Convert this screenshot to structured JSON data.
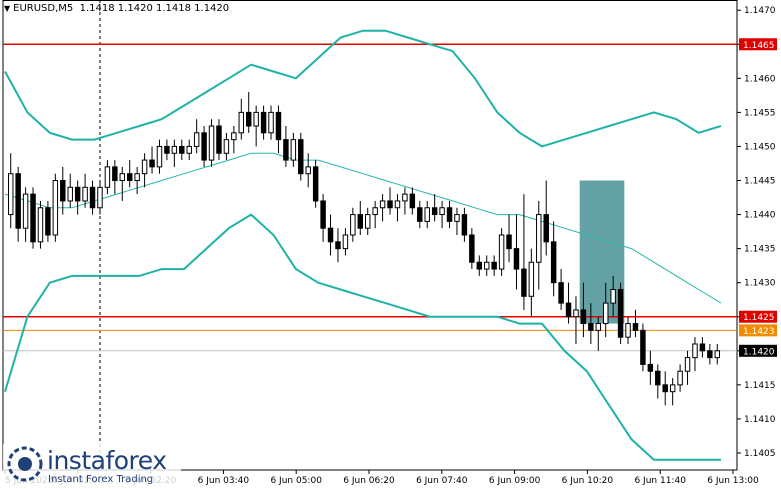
{
  "window": {
    "symbol_label": "EURUSD,M5",
    "ohlc": "1.1418 1.1420 1.1418 1.1420"
  },
  "colors": {
    "background": "#ffffff",
    "candle": "#000000",
    "bollinger_outer": "#1fb3a7",
    "bollinger_middle": "#27b5ab",
    "level_red": "#e00000",
    "level_orange": "#f08c00",
    "current_price_line": "#c0c0c0",
    "highlight_box": "#3d8a8e",
    "axis_tag_red": "#e00000",
    "axis_tag_orange": "#f08c00",
    "axis_tag_current": "#000000",
    "logo_text": "#1f3f78"
  },
  "price_axis": {
    "labels": [
      "1.1470",
      "1.1465",
      "1.1460",
      "1.1455",
      "1.1450",
      "1.1445",
      "1.1440",
      "1.1435",
      "1.1430",
      "1.1425",
      "1.1420",
      "1.1415",
      "1.1410",
      "1.1405"
    ]
  },
  "time_axis": {
    "labels": [
      "5 Jun 2025",
      "6 Jun 01:00",
      "6 Jun 02:20",
      "6 Jun 03:40",
      "6 Jun 05:00",
      "6 Jun 06:20",
      "6 Jun 07:40",
      "6 Jun 09:00",
      "6 Jun 10:20",
      "6 Jun 11:40",
      "6 Jun 13:00"
    ]
  },
  "price_tags": [
    {
      "name": "level-1.1465",
      "text": "1.1465",
      "color": "#e00000"
    },
    {
      "name": "level-1.1425",
      "text": "1.1425",
      "color": "#e00000"
    },
    {
      "name": "level-1.1423",
      "text": "1.1423",
      "color": "#f08c00"
    },
    {
      "name": "current-price",
      "text": "1.1420",
      "color": "#000000"
    }
  ],
  "logo": {
    "name": "instaforex",
    "tagline": "Instant Forex Trading"
  },
  "chart_data": {
    "type": "candlestick",
    "symbol": "EURUSD",
    "timeframe": "M5",
    "ylim": [
      1.14025,
      1.14715
    ],
    "y_ticks": [
      1.1405,
      1.141,
      1.1415,
      1.142,
      1.1425,
      1.143,
      1.1435,
      1.144,
      1.1445,
      1.145,
      1.1455,
      1.146,
      1.1465,
      1.147
    ],
    "horizontal_levels": [
      {
        "price": 1.1465,
        "color": "#e00000",
        "style": "solid"
      },
      {
        "price": 1.1425,
        "color": "#e00000",
        "style": "solid"
      },
      {
        "price": 1.1423,
        "color": "#f08c00",
        "style": "solid"
      },
      {
        "price": 1.142,
        "color": "#c0c0c0",
        "style": "solid"
      }
    ],
    "vertical_marker": {
      "bar_index": 12,
      "style": "dashed"
    },
    "highlight_zone": {
      "from_bar": 77,
      "to_bar": 82,
      "price_low": 1.1424,
      "price_high": 1.1445
    },
    "candles": [
      [
        1.144,
        1.1449,
        1.1438,
        1.1446
      ],
      [
        1.1446,
        1.1447,
        1.1436,
        1.1438
      ],
      [
        1.1438,
        1.1444,
        1.1436,
        1.1443
      ],
      [
        1.1443,
        1.1444,
        1.1435,
        1.1436
      ],
      [
        1.1436,
        1.1442,
        1.1435,
        1.1441
      ],
      [
        1.1441,
        1.1442,
        1.1436,
        1.1437
      ],
      [
        1.1437,
        1.1446,
        1.1436,
        1.1445
      ],
      [
        1.1445,
        1.1447,
        1.144,
        1.1442
      ],
      [
        1.1442,
        1.1446,
        1.1441,
        1.1444
      ],
      [
        1.1444,
        1.1445,
        1.144,
        1.1442
      ],
      [
        1.1442,
        1.1446,
        1.1441,
        1.1444
      ],
      [
        1.1444,
        1.1445,
        1.144,
        1.1441
      ],
      [
        1.1441,
        1.1445,
        1.144,
        1.1444
      ],
      [
        1.1444,
        1.1448,
        1.1443,
        1.1447
      ],
      [
        1.1447,
        1.1448,
        1.1443,
        1.1445
      ],
      [
        1.1445,
        1.1447,
        1.1442,
        1.1446
      ],
      [
        1.1446,
        1.1448,
        1.1444,
        1.1445
      ],
      [
        1.1445,
        1.1447,
        1.1443,
        1.1446
      ],
      [
        1.1446,
        1.1449,
        1.1444,
        1.1448
      ],
      [
        1.1448,
        1.145,
        1.1446,
        1.1447
      ],
      [
        1.1447,
        1.1451,
        1.1446,
        1.145
      ],
      [
        1.145,
        1.1451,
        1.1448,
        1.1449
      ],
      [
        1.1449,
        1.1451,
        1.1447,
        1.145
      ],
      [
        1.145,
        1.1451,
        1.1448,
        1.1449
      ],
      [
        1.1449,
        1.1451,
        1.1448,
        1.145
      ],
      [
        1.145,
        1.1454,
        1.1449,
        1.1452
      ],
      [
        1.1452,
        1.1453,
        1.1447,
        1.1448
      ],
      [
        1.1448,
        1.1454,
        1.1447,
        1.1453
      ],
      [
        1.1453,
        1.1454,
        1.1448,
        1.1449
      ],
      [
        1.1449,
        1.1452,
        1.1448,
        1.1451
      ],
      [
        1.1451,
        1.1453,
        1.1449,
        1.1452
      ],
      [
        1.1452,
        1.1457,
        1.1451,
        1.1455
      ],
      [
        1.1455,
        1.1458,
        1.1452,
        1.1453
      ],
      [
        1.1453,
        1.1456,
        1.145,
        1.1455
      ],
      [
        1.1455,
        1.1456,
        1.1451,
        1.1452
      ],
      [
        1.1452,
        1.1456,
        1.1451,
        1.1455
      ],
      [
        1.1455,
        1.1456,
        1.1449,
        1.1451
      ],
      [
        1.1451,
        1.1453,
        1.1447,
        1.1448
      ],
      [
        1.1448,
        1.1452,
        1.1447,
        1.1451
      ],
      [
        1.1451,
        1.1452,
        1.1445,
        1.1446
      ],
      [
        1.1446,
        1.1449,
        1.1444,
        1.1447
      ],
      [
        1.1447,
        1.1448,
        1.1441,
        1.1442
      ],
      [
        1.1442,
        1.1443,
        1.1436,
        1.1438
      ],
      [
        1.1438,
        1.144,
        1.1434,
        1.1436
      ],
      [
        1.1436,
        1.1438,
        1.1433,
        1.1435
      ],
      [
        1.1435,
        1.1438,
        1.1434,
        1.1437
      ],
      [
        1.1437,
        1.1441,
        1.1436,
        1.144
      ],
      [
        1.144,
        1.1442,
        1.1437,
        1.1438
      ],
      [
        1.1438,
        1.1441,
        1.1437,
        1.144
      ],
      [
        1.144,
        1.1442,
        1.1438,
        1.1441
      ],
      [
        1.1441,
        1.1443,
        1.1439,
        1.1442
      ],
      [
        1.1442,
        1.1444,
        1.144,
        1.1441
      ],
      [
        1.1441,
        1.1443,
        1.1439,
        1.1442
      ],
      [
        1.1442,
        1.1444,
        1.144,
        1.1443
      ],
      [
        1.1443,
        1.1444,
        1.144,
        1.1441
      ],
      [
        1.1441,
        1.1442,
        1.1438,
        1.1439
      ],
      [
        1.1439,
        1.1442,
        1.1438,
        1.1441
      ],
      [
        1.1441,
        1.1443,
        1.1439,
        1.144
      ],
      [
        1.144,
        1.1442,
        1.1438,
        1.1441
      ],
      [
        1.1441,
        1.1442,
        1.1438,
        1.1439
      ],
      [
        1.1439,
        1.1441,
        1.1437,
        1.144
      ],
      [
        1.144,
        1.1441,
        1.1436,
        1.1437
      ],
      [
        1.1437,
        1.1438,
        1.1432,
        1.1433
      ],
      [
        1.1433,
        1.1434,
        1.1431,
        1.1432
      ],
      [
        1.1432,
        1.1434,
        1.1431,
        1.1433
      ],
      [
        1.1433,
        1.1434,
        1.1431,
        1.1432
      ],
      [
        1.1432,
        1.1438,
        1.1431,
        1.1437
      ],
      [
        1.1437,
        1.144,
        1.1433,
        1.1435
      ],
      [
        1.1435,
        1.144,
        1.1429,
        1.1432
      ],
      [
        1.1432,
        1.1443,
        1.1426,
        1.1428
      ],
      [
        1.1428,
        1.1435,
        1.1425,
        1.1433
      ],
      [
        1.1433,
        1.1442,
        1.1429,
        1.144
      ],
      [
        1.144,
        1.1445,
        1.1434,
        1.1436
      ],
      [
        1.1436,
        1.1439,
        1.1428,
        1.143
      ],
      [
        1.143,
        1.1432,
        1.1426,
        1.1427
      ],
      [
        1.1427,
        1.143,
        1.1424,
        1.1425
      ],
      [
        1.1425,
        1.1428,
        1.1421,
        1.1426
      ],
      [
        1.1426,
        1.143,
        1.1422,
        1.1424
      ],
      [
        1.1424,
        1.1427,
        1.1421,
        1.1423
      ],
      [
        1.1423,
        1.1425,
        1.142,
        1.1424
      ],
      [
        1.1424,
        1.143,
        1.1422,
        1.1427
      ],
      [
        1.1427,
        1.1431,
        1.1425,
        1.1429
      ],
      [
        1.1429,
        1.143,
        1.1421,
        1.1422
      ],
      [
        1.1422,
        1.1425,
        1.1421,
        1.1424
      ],
      [
        1.1424,
        1.1426,
        1.1422,
        1.1423
      ],
      [
        1.1423,
        1.1424,
        1.1417,
        1.1418
      ],
      [
        1.1418,
        1.142,
        1.1415,
        1.1417
      ],
      [
        1.1417,
        1.1418,
        1.1413,
        1.1415
      ],
      [
        1.1415,
        1.1417,
        1.1412,
        1.1414
      ],
      [
        1.1414,
        1.1416,
        1.1412,
        1.1415
      ],
      [
        1.1415,
        1.1418,
        1.1414,
        1.1417
      ],
      [
        1.1417,
        1.142,
        1.1415,
        1.1419
      ],
      [
        1.1419,
        1.1422,
        1.1417,
        1.1421
      ],
      [
        1.1421,
        1.1422,
        1.1419,
        1.142
      ],
      [
        1.142,
        1.1421,
        1.1418,
        1.1419
      ],
      [
        1.1419,
        1.1421,
        1.1418,
        1.142
      ]
    ],
    "bollinger": {
      "upper": [
        1.1461,
        1.1455,
        1.1452,
        1.1451,
        1.1451,
        1.1452,
        1.1453,
        1.1454,
        1.1456,
        1.1458,
        1.146,
        1.1462,
        1.1461,
        1.146,
        1.1463,
        1.1466,
        1.1467,
        1.1467,
        1.1466,
        1.1465,
        1.1464,
        1.146,
        1.1455,
        1.1452,
        1.145,
        1.1451,
        1.1452,
        1.1453,
        1.1454,
        1.1455,
        1.1454,
        1.1452,
        1.1453
      ],
      "middle": [
        1.1443,
        1.1442,
        1.1441,
        1.1441,
        1.1442,
        1.1443,
        1.1444,
        1.1445,
        1.1446,
        1.1447,
        1.1448,
        1.1449,
        1.1449,
        1.1448,
        1.1448,
        1.1447,
        1.1446,
        1.1445,
        1.1444,
        1.1443,
        1.1442,
        1.1441,
        1.144,
        1.144,
        1.1439,
        1.1438,
        1.1437,
        1.1436,
        1.1435,
        1.1433,
        1.1431,
        1.1429,
        1.1427
      ],
      "lower": [
        1.1414,
        1.1425,
        1.143,
        1.1431,
        1.1431,
        1.1431,
        1.1431,
        1.1432,
        1.1432,
        1.1435,
        1.1438,
        1.144,
        1.1437,
        1.1432,
        1.143,
        1.1429,
        1.1428,
        1.1427,
        1.1426,
        1.1425,
        1.1425,
        1.1425,
        1.1425,
        1.1424,
        1.1424,
        1.142,
        1.1417,
        1.1412,
        1.1407,
        1.1404,
        1.1404,
        1.1404,
        1.1404
      ]
    }
  }
}
